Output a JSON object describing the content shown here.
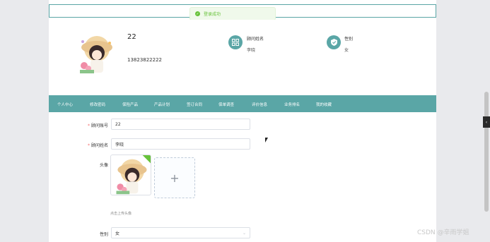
{
  "toast": {
    "message": "登录成功"
  },
  "profile": {
    "username": "22",
    "phone": "13823822222",
    "name_label": "顾问姓名",
    "name_value": "李晓",
    "gender_label": "性别",
    "gender_value": "女"
  },
  "nav": {
    "items": [
      "个人中心",
      "修改密码",
      "保险产品",
      "产品计划",
      "签订合同",
      "保单调查",
      "评价信息",
      "业务排名",
      "我的收藏"
    ]
  },
  "form": {
    "account_label": "顾问账号",
    "account_value": "22",
    "name_label": "顾问姓名",
    "name_value": "李晓",
    "avatar_label": "头像",
    "avatar_hint": "点击上传头像",
    "upload_plus": "+",
    "gender_label": "性别",
    "gender_value": "女"
  },
  "watermark": "CSDN @辛雨学姐",
  "colors": {
    "accent": "#5aa6a6",
    "success": "#67c23a",
    "required": "#f56c6c"
  }
}
